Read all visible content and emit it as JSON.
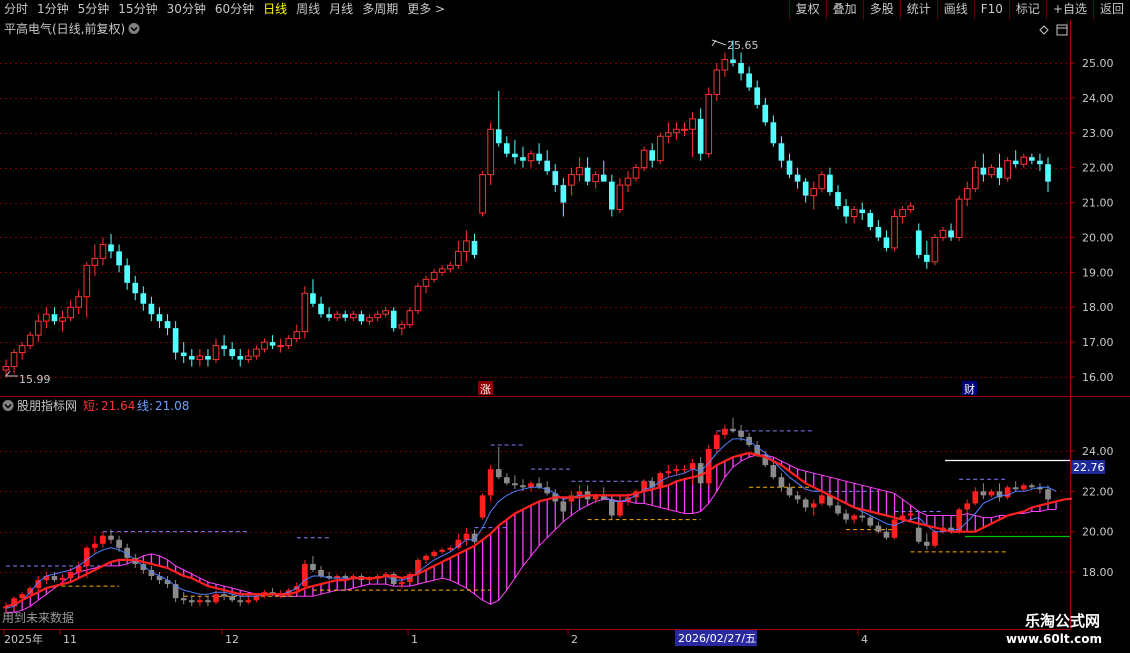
{
  "toolbar": {
    "periods": [
      "分时",
      "1分钟",
      "5分钟",
      "15分钟",
      "30分钟",
      "60分钟",
      "日线",
      "周线",
      "月线",
      "多周期",
      "更多 >"
    ],
    "active_period": "日线",
    "tools": [
      "复权",
      "叠加",
      "多股",
      "统计",
      "画线",
      "F10",
      "标记",
      "+自选",
      "返回"
    ]
  },
  "main_panel": {
    "title": "平高电气(日线,前复权)",
    "high_label": "25.65",
    "low_label": "15.99",
    "y_ticks": [
      "25.00",
      "24.00",
      "23.00",
      "22.00",
      "21.00",
      "20.00",
      "19.00",
      "18.00",
      "17.00",
      "16.00"
    ],
    "markers": [
      "涨",
      "财"
    ]
  },
  "sub_panel": {
    "title": "股朋指标网",
    "short_label": "短:",
    "short_value": "21.64",
    "line_label": "线:",
    "line_value": "21.08",
    "y_ticks": [
      "24.00",
      "22.00",
      "20.00",
      "18.00"
    ],
    "price_tag": "22.76",
    "note": "用到未来数据"
  },
  "x_axis": {
    "labels": [
      "2025年",
      "11",
      "12",
      "1",
      "2",
      "4"
    ],
    "cursor_date": "2026/02/27/五"
  },
  "watermark": {
    "name": "乐淘公式网",
    "url": "www.60lt.com"
  },
  "colors": {
    "up": "#ff3232",
    "down": "#54ffff",
    "ma_short": "#ff2020",
    "line_blue": "#5080ff",
    "fill": "#ff40ff",
    "grid": "#7a0000",
    "active": "#ffff00"
  },
  "chart_data": {
    "type": "candlestick",
    "ylim_main": [
      15.8,
      25.9
    ],
    "ylim_sub": [
      16.8,
      25.2
    ],
    "candles": [
      [
        16.2,
        16.5,
        16.0,
        16.3
      ],
      [
        16.3,
        16.8,
        16.1,
        16.7
      ],
      [
        16.7,
        17.0,
        16.5,
        16.9
      ],
      [
        16.9,
        17.3,
        16.8,
        17.2
      ],
      [
        17.2,
        17.8,
        17.0,
        17.6
      ],
      [
        17.6,
        18.0,
        17.4,
        17.8
      ],
      [
        17.8,
        18.0,
        17.5,
        17.6
      ],
      [
        17.6,
        17.9,
        17.3,
        17.7
      ],
      [
        17.7,
        18.2,
        17.6,
        18.0
      ],
      [
        18.0,
        18.5,
        17.8,
        18.3
      ],
      [
        18.3,
        19.3,
        17.7,
        19.2
      ],
      [
        19.2,
        19.8,
        18.9,
        19.4
      ],
      [
        19.4,
        20.0,
        19.2,
        19.8
      ],
      [
        19.8,
        20.1,
        19.4,
        19.6
      ],
      [
        19.6,
        19.8,
        19.0,
        19.2
      ],
      [
        19.2,
        19.4,
        18.5,
        18.7
      ],
      [
        18.7,
        18.9,
        18.2,
        18.4
      ],
      [
        18.4,
        18.6,
        17.9,
        18.1
      ],
      [
        18.1,
        18.3,
        17.6,
        17.8
      ],
      [
        17.8,
        18.0,
        17.4,
        17.6
      ],
      [
        17.6,
        17.8,
        17.2,
        17.4
      ],
      [
        17.4,
        17.6,
        16.5,
        16.7
      ],
      [
        16.7,
        17.0,
        16.4,
        16.6
      ],
      [
        16.6,
        16.8,
        16.3,
        16.5
      ],
      [
        16.5,
        16.8,
        16.3,
        16.6
      ],
      [
        16.6,
        16.8,
        16.3,
        16.5
      ],
      [
        16.5,
        17.1,
        16.4,
        16.9
      ],
      [
        16.9,
        17.2,
        16.6,
        16.8
      ],
      [
        16.8,
        17.0,
        16.5,
        16.6
      ],
      [
        16.6,
        16.8,
        16.3,
        16.5
      ],
      [
        16.5,
        16.8,
        16.4,
        16.6
      ],
      [
        16.6,
        16.9,
        16.5,
        16.8
      ],
      [
        16.8,
        17.1,
        16.7,
        17.0
      ],
      [
        17.0,
        17.2,
        16.8,
        16.9
      ],
      [
        16.9,
        17.1,
        16.7,
        16.9
      ],
      [
        16.9,
        17.2,
        16.8,
        17.1
      ],
      [
        17.1,
        17.5,
        17.0,
        17.3
      ],
      [
        17.3,
        18.6,
        17.1,
        18.4
      ],
      [
        18.4,
        18.8,
        18.0,
        18.1
      ],
      [
        18.1,
        18.3,
        17.7,
        17.8
      ],
      [
        17.8,
        18.0,
        17.6,
        17.7
      ],
      [
        17.7,
        17.9,
        17.6,
        17.8
      ],
      [
        17.8,
        17.9,
        17.6,
        17.7
      ],
      [
        17.7,
        17.9,
        17.6,
        17.8
      ],
      [
        17.8,
        17.9,
        17.5,
        17.6
      ],
      [
        17.6,
        17.8,
        17.5,
        17.7
      ],
      [
        17.7,
        17.9,
        17.6,
        17.8
      ],
      [
        17.8,
        18.0,
        17.7,
        17.9
      ],
      [
        17.9,
        18.0,
        17.3,
        17.4
      ],
      [
        17.4,
        17.6,
        17.2,
        17.5
      ],
      [
        17.5,
        18.0,
        17.4,
        17.9
      ],
      [
        17.9,
        18.7,
        17.8,
        18.6
      ],
      [
        18.6,
        18.9,
        18.4,
        18.8
      ],
      [
        18.8,
        19.1,
        18.7,
        19.0
      ],
      [
        19.0,
        19.2,
        18.9,
        19.1
      ],
      [
        19.1,
        19.3,
        19.0,
        19.2
      ],
      [
        19.2,
        19.9,
        19.1,
        19.6
      ],
      [
        19.6,
        20.2,
        19.3,
        19.9
      ],
      [
        19.9,
        20.1,
        19.4,
        19.5
      ],
      [
        20.7,
        21.9,
        20.6,
        21.8
      ],
      [
        21.8,
        23.3,
        21.5,
        23.1
      ],
      [
        23.1,
        24.2,
        22.6,
        22.7
      ],
      [
        22.7,
        22.9,
        22.3,
        22.4
      ],
      [
        22.4,
        22.8,
        22.1,
        22.3
      ],
      [
        22.3,
        22.6,
        22.0,
        22.2
      ],
      [
        22.2,
        22.5,
        22.0,
        22.4
      ],
      [
        22.4,
        22.7,
        22.1,
        22.2
      ],
      [
        22.2,
        22.5,
        21.8,
        21.9
      ],
      [
        21.9,
        22.1,
        21.3,
        21.5
      ],
      [
        21.5,
        21.7,
        20.6,
        21.0
      ],
      [
        21.5,
        22.0,
        21.2,
        21.8
      ],
      [
        21.8,
        22.3,
        21.6,
        22.0
      ],
      [
        22.0,
        22.3,
        21.5,
        21.6
      ],
      [
        21.6,
        21.9,
        21.4,
        21.8
      ],
      [
        21.8,
        22.2,
        21.6,
        21.6
      ],
      [
        21.6,
        21.8,
        20.6,
        20.8
      ],
      [
        20.8,
        21.7,
        20.7,
        21.5
      ],
      [
        21.5,
        21.9,
        21.3,
        21.7
      ],
      [
        21.7,
        22.1,
        21.6,
        22.0
      ],
      [
        22.0,
        22.6,
        21.9,
        22.5
      ],
      [
        22.5,
        22.7,
        22.0,
        22.2
      ],
      [
        22.2,
        23.0,
        22.1,
        22.9
      ],
      [
        22.9,
        23.3,
        22.7,
        23.0
      ],
      [
        23.0,
        23.3,
        22.8,
        23.1
      ],
      [
        23.1,
        23.3,
        22.9,
        23.1
      ],
      [
        23.1,
        23.6,
        22.3,
        23.4
      ],
      [
        23.4,
        23.7,
        22.2,
        22.4
      ],
      [
        22.4,
        24.3,
        22.3,
        24.1
      ],
      [
        24.1,
        25.0,
        23.9,
        24.8
      ],
      [
        24.8,
        25.3,
        24.6,
        25.1
      ],
      [
        25.1,
        25.65,
        24.9,
        25.0
      ],
      [
        25.0,
        25.3,
        24.5,
        24.7
      ],
      [
        24.7,
        24.9,
        24.2,
        24.3
      ],
      [
        24.3,
        24.5,
        23.7,
        23.8
      ],
      [
        23.8,
        24.0,
        23.2,
        23.3
      ],
      [
        23.3,
        23.5,
        22.6,
        22.7
      ],
      [
        22.7,
        22.9,
        22.0,
        22.2
      ],
      [
        22.2,
        22.4,
        21.7,
        21.8
      ],
      [
        21.8,
        22.0,
        21.4,
        21.6
      ],
      [
        21.6,
        21.7,
        21.0,
        21.2
      ],
      [
        21.2,
        21.6,
        20.8,
        21.4
      ],
      [
        21.4,
        21.9,
        21.3,
        21.8
      ],
      [
        21.8,
        22.0,
        21.2,
        21.3
      ],
      [
        21.3,
        21.5,
        20.8,
        20.9
      ],
      [
        20.9,
        21.1,
        20.4,
        20.6
      ],
      [
        20.6,
        20.9,
        20.4,
        20.8
      ],
      [
        20.8,
        21.0,
        20.5,
        20.7
      ],
      [
        20.7,
        20.8,
        20.2,
        20.3
      ],
      [
        20.3,
        20.5,
        19.9,
        20.0
      ],
      [
        20.0,
        20.2,
        19.6,
        19.7
      ],
      [
        19.7,
        20.8,
        19.6,
        20.6
      ],
      [
        20.6,
        20.9,
        20.4,
        20.8
      ],
      [
        20.8,
        21.0,
        20.7,
        20.9
      ],
      [
        20.2,
        20.4,
        19.4,
        19.5
      ],
      [
        19.5,
        19.9,
        19.1,
        19.3
      ],
      [
        19.3,
        20.1,
        19.2,
        20.0
      ],
      [
        20.0,
        20.3,
        19.9,
        20.2
      ],
      [
        20.2,
        20.4,
        19.9,
        20.0
      ],
      [
        20.0,
        21.2,
        19.9,
        21.1
      ],
      [
        21.1,
        21.6,
        20.9,
        21.4
      ],
      [
        21.4,
        22.2,
        21.3,
        22.0
      ],
      [
        22.0,
        22.4,
        21.6,
        21.8
      ],
      [
        21.8,
        22.1,
        21.7,
        22.0
      ],
      [
        22.0,
        22.4,
        21.5,
        21.7
      ],
      [
        21.7,
        22.3,
        21.6,
        22.2
      ],
      [
        22.2,
        22.5,
        22.0,
        22.1
      ],
      [
        22.1,
        22.4,
        22.0,
        22.3
      ],
      [
        22.3,
        22.4,
        22.1,
        22.2
      ],
      [
        22.2,
        22.4,
        21.9,
        22.1
      ],
      [
        22.1,
        22.3,
        21.3,
        21.6
      ]
    ],
    "short_line": [
      16.3,
      16.4,
      16.6,
      16.8,
      17.0,
      17.2,
      17.3,
      17.4,
      17.5,
      17.7,
      17.9,
      18.1,
      18.3,
      18.5,
      18.6,
      18.6,
      18.6,
      18.5,
      18.4,
      18.3,
      18.2,
      18.0,
      17.8,
      17.7,
      17.5,
      17.3,
      17.2,
      17.1,
      17.0,
      16.9,
      16.9,
      16.9,
      16.9,
      16.9,
      16.9,
      16.9,
      17.0,
      17.2,
      17.3,
      17.4,
      17.5,
      17.6,
      17.6,
      17.7,
      17.7,
      17.7,
      17.7,
      17.8,
      17.8,
      17.7,
      17.8,
      17.9,
      18.1,
      18.3,
      18.5,
      18.7,
      18.9,
      19.1,
      19.3,
      19.6,
      19.9,
      20.3,
      20.6,
      20.9,
      21.1,
      21.3,
      21.5,
      21.6,
      21.7,
      21.7,
      21.7,
      21.7,
      21.8,
      21.8,
      21.8,
      21.8,
      21.8,
      21.8,
      21.9,
      22.0,
      22.1,
      22.2,
      22.3,
      22.5,
      22.6,
      22.7,
      22.8,
      23.0,
      23.3,
      23.5,
      23.7,
      23.8,
      23.9,
      23.8,
      23.7,
      23.5,
      23.3,
      23.0,
      22.7,
      22.4,
      22.2,
      22.0,
      21.8,
      21.6,
      21.4,
      21.2,
      21.1,
      21.0,
      20.9,
      20.8,
      20.7,
      20.6,
      20.5,
      20.4,
      20.3,
      20.2,
      20.1,
      20.0,
      20.0,
      20.0,
      20.0,
      20.2,
      20.4,
      20.6,
      20.8,
      20.9,
      21.0,
      21.2,
      21.3,
      21.4,
      21.5,
      21.6,
      21.64
    ],
    "line_values": [
      16.0,
      16.0,
      16.1,
      16.3,
      16.6,
      16.9,
      17.2,
      17.5,
      17.8,
      18.0,
      18.1,
      18.2,
      18.3,
      18.3,
      18.3,
      18.4,
      18.6,
      18.8,
      18.9,
      18.8,
      18.6,
      18.3,
      18.1,
      17.9,
      17.7,
      17.5,
      17.4,
      17.3,
      17.2,
      17.1,
      17.0,
      16.9,
      16.9,
      16.9,
      16.8,
      16.8,
      16.8,
      16.8,
      16.8,
      16.9,
      17.0,
      17.1,
      17.1,
      17.2,
      17.3,
      17.4,
      17.4,
      17.4,
      17.3,
      17.3,
      17.3,
      17.4,
      17.5,
      17.6,
      17.7,
      17.6,
      17.4,
      17.2,
      16.9,
      16.6,
      16.4,
      16.6,
      17.1,
      17.7,
      18.3,
      18.8,
      19.3,
      19.7,
      20.1,
      20.5,
      20.8,
      21.1,
      21.3,
      21.5,
      21.6,
      21.6,
      21.5,
      21.5,
      21.4,
      21.4,
      21.3,
      21.2,
      21.1,
      21.0,
      20.9,
      20.9,
      21.0,
      21.4,
      22.0,
      22.7,
      23.2,
      23.5,
      23.7,
      23.8,
      23.8,
      23.7,
      23.5,
      23.3,
      23.1,
      23.0,
      22.9,
      22.8,
      22.7,
      22.6,
      22.5,
      22.4,
      22.3,
      22.2,
      22.1,
      22.0,
      21.9,
      21.6,
      21.3,
      21.0,
      20.8,
      20.8,
      20.8,
      20.8,
      20.8,
      20.9,
      20.8,
      20.7,
      20.7,
      20.8,
      20.8,
      20.9,
      20.9,
      21.0,
      21.0,
      21.1,
      21.1
    ],
    "blue_line": [
      16.2,
      16.3,
      16.6,
      17.0,
      17.5,
      17.8,
      17.9,
      18.0,
      18.1,
      18.3,
      18.6,
      18.9,
      19.1,
      19.2,
      19.1,
      18.9,
      18.6,
      18.3,
      18.0,
      17.8,
      17.6,
      17.3,
      17.1,
      17.0,
      16.9,
      16.9,
      17.0,
      17.0,
      16.9,
      16.8,
      16.8,
      16.8,
      16.9,
      16.9,
      16.9,
      17.0,
      17.2,
      17.6,
      17.8,
      17.8,
      17.7,
      17.7,
      17.7,
      17.7,
      17.7,
      17.7,
      17.7,
      17.8,
      17.6,
      17.6,
      17.7,
      18.0,
      18.3,
      18.6,
      18.8,
      19.0,
      19.3,
      19.6,
      19.6,
      20.2,
      21.0,
      21.5,
      21.8,
      22.0,
      22.1,
      22.2,
      22.2,
      22.1,
      21.9,
      21.6,
      21.7,
      21.8,
      21.8,
      21.8,
      21.8,
      21.5,
      21.5,
      21.6,
      21.8,
      22.1,
      22.2,
      22.5,
      22.7,
      22.8,
      22.9,
      23.1,
      23.0,
      23.4,
      23.9,
      24.3,
      24.6,
      24.6,
      24.5,
      24.2,
      23.9,
      23.5,
      23.1,
      22.7,
      22.4,
      22.1,
      22.0,
      22.0,
      21.8,
      21.6,
      21.4,
      21.2,
      21.0,
      20.8,
      20.6,
      20.4,
      20.3,
      20.5,
      20.6,
      20.7,
      20.3,
      20.0,
      20.0,
      20.1,
      20.1,
      20.5,
      20.9,
      21.4,
      21.6,
      21.8,
      21.8,
      22.0,
      22.0,
      22.1,
      22.2,
      22.2,
      22.0
    ]
  }
}
